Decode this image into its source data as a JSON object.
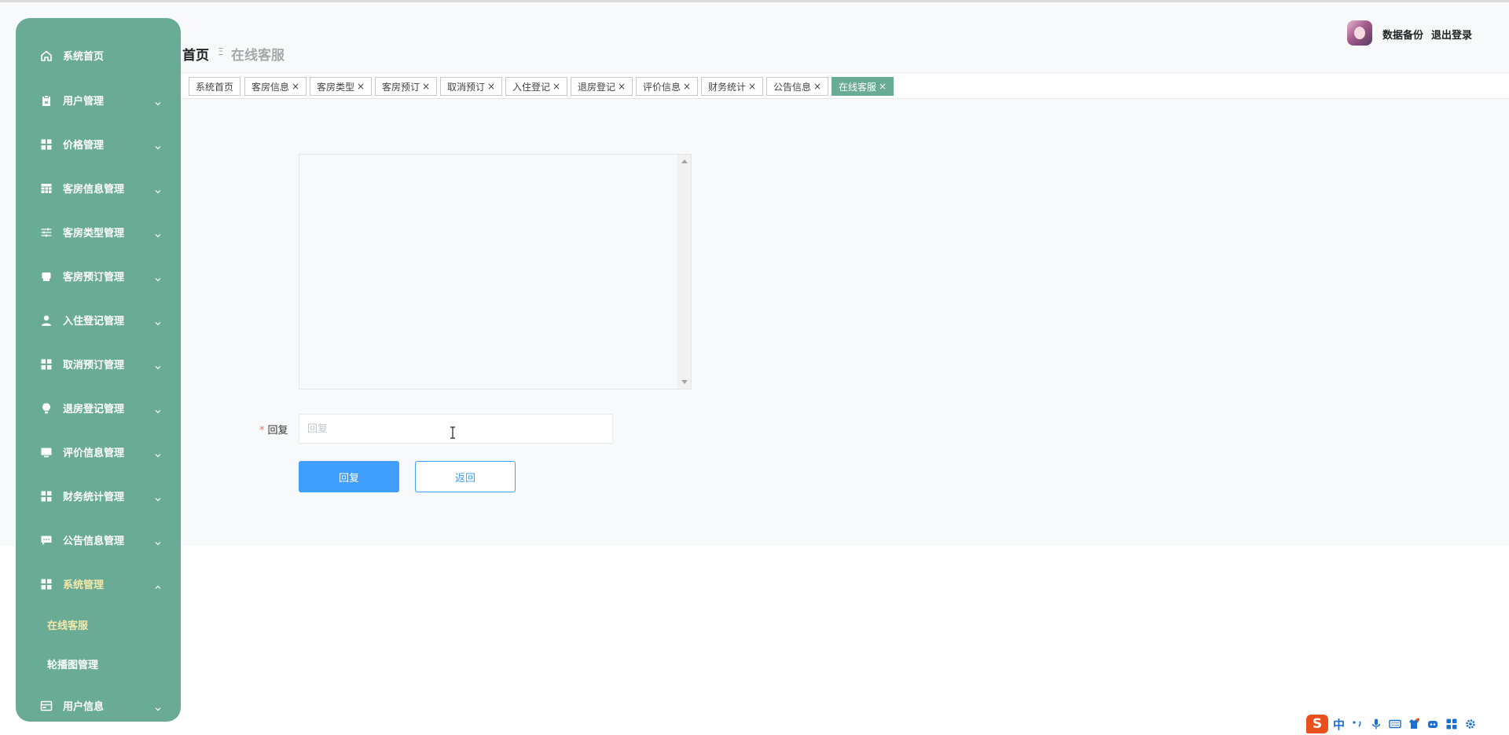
{
  "sidebar": {
    "items": [
      {
        "label": "系统首页",
        "icon": "home-icon",
        "chevron": "none"
      },
      {
        "label": "用户管理",
        "icon": "clipboard-icon",
        "chevron": "down"
      },
      {
        "label": "价格管理",
        "icon": "grid-icon",
        "chevron": "down"
      },
      {
        "label": "客房信息管理",
        "icon": "table-icon",
        "chevron": "down"
      },
      {
        "label": "客房类型管理",
        "icon": "sliders-icon",
        "chevron": "down"
      },
      {
        "label": "客房预订管理",
        "icon": "print-icon",
        "chevron": "down"
      },
      {
        "label": "入住登记管理",
        "icon": "user-icon",
        "chevron": "down"
      },
      {
        "label": "取消预订管理",
        "icon": "grid-icon",
        "chevron": "down"
      },
      {
        "label": "退房登记管理",
        "icon": "bulb-icon",
        "chevron": "down"
      },
      {
        "label": "评价信息管理",
        "icon": "monitor-icon",
        "chevron": "down"
      },
      {
        "label": "财务统计管理",
        "icon": "grid-icon",
        "chevron": "down"
      },
      {
        "label": "公告信息管理",
        "icon": "chat-icon",
        "chevron": "down"
      },
      {
        "label": "系统管理",
        "icon": "grid-icon",
        "chevron": "up"
      }
    ],
    "sub_items": [
      {
        "label": "在线客服",
        "active": true
      },
      {
        "label": "轮播图管理",
        "active": false
      }
    ],
    "footer_item": {
      "label": "用户信息",
      "icon": "card-icon",
      "chevron": "down"
    }
  },
  "header": {
    "breadcrumb_home": "首页",
    "breadcrumb_separator": "Ξ",
    "breadcrumb_current": "在线客服",
    "backup_label": "数据备份",
    "logout_label": "退出登录"
  },
  "tabs": [
    {
      "label": "系统首页",
      "closable": false,
      "active": false
    },
    {
      "label": "客房信息",
      "closable": true,
      "active": false
    },
    {
      "label": "客房类型",
      "closable": true,
      "active": false
    },
    {
      "label": "客房预订",
      "closable": true,
      "active": false
    },
    {
      "label": "取消预订",
      "closable": true,
      "active": false
    },
    {
      "label": "入住登记",
      "closable": true,
      "active": false
    },
    {
      "label": "退房登记",
      "closable": true,
      "active": false
    },
    {
      "label": "评价信息",
      "closable": true,
      "active": false
    },
    {
      "label": "财务统计",
      "closable": true,
      "active": false
    },
    {
      "label": "公告信息",
      "closable": true,
      "active": false
    },
    {
      "label": "在线客服",
      "closable": true,
      "active": true
    }
  ],
  "tab_close_glyph": "×",
  "form": {
    "required_mark": "*",
    "reply_label": "回复",
    "reply_placeholder": "回复",
    "reply_value": "",
    "submit_label": "回复",
    "back_label": "返回"
  },
  "ime": {
    "logo": "S",
    "lang": "中"
  },
  "colors": {
    "sidebar_bg": "#6aab96",
    "active_text": "#f6e8a8",
    "primary": "#409eff",
    "ime_orange": "#e8501e"
  }
}
